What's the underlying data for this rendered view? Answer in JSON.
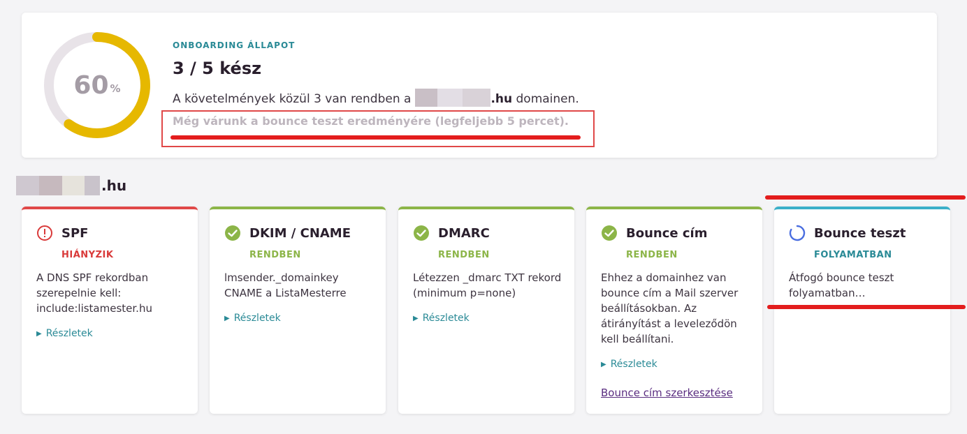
{
  "summary": {
    "progress_percent": 60,
    "percent_value": "60",
    "percent_sign": "%",
    "kicker": "ONBOARDING ÁLLAPOT",
    "headline": "3 / 5 kész",
    "desc_prefix": "A követelmények közül 3 van rendben a",
    "desc_domain": ".hu",
    "desc_suffix": "domainen.",
    "waiting": "Még várunk a bounce teszt eredményére (legfeljebb 5 percet)."
  },
  "domain": {
    "suffix": ".hu"
  },
  "cards": [
    {
      "title": "SPF",
      "status": "HIÁNYZIK",
      "body": "A DNS SPF rekordban szerepelnie kell: include:listamester.hu",
      "details": "Részletek"
    },
    {
      "title": "DKIM / CNAME",
      "status": "RENDBEN",
      "body": "lmsender._domainkey CNAME a ListaMesterre",
      "details": "Részletek"
    },
    {
      "title": "DMARC",
      "status": "RENDBEN",
      "body": "Létezzen _dmarc TXT rekord (minimum p=none)",
      "details": "Részletek"
    },
    {
      "title": "Bounce cím",
      "status": "RENDBEN",
      "body": "Ehhez a domainhez van bounce cím a Mail szerver beállításokban. Az átirányítást a leveleződön kell beállítani.",
      "details": "Részletek",
      "edit_link": "Bounce cím szerkesztése"
    },
    {
      "title": "Bounce teszt",
      "status": "FOLYAMATBAN",
      "body": "Átfogó bounce teszt folyamatban…"
    }
  ],
  "colors": {
    "ring_fill": "#e6b800",
    "ring_track": "#e8e3e8",
    "ok_green": "#8cb548",
    "error_red": "#d93a3a",
    "progress_teal": "#2a8a96",
    "spinner_blue": "#4a6ee0",
    "annotation_red": "#e31d1d"
  }
}
